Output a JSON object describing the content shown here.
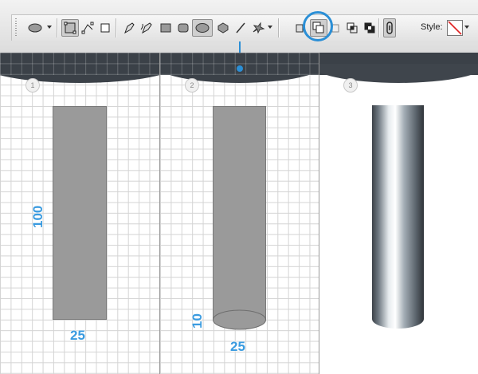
{
  "toolbar": {
    "style_label": "Style:",
    "tools": [
      {
        "name": "ellipse-preset-picker",
        "icon": "ellipse-icon"
      },
      {
        "name": "shape-layers-mode",
        "icon": "shape-layers-icon"
      },
      {
        "name": "paths-mode",
        "icon": "paths-icon"
      },
      {
        "name": "fill-pixels-mode",
        "icon": "fill-pixels-icon"
      },
      {
        "name": "pen-tool",
        "icon": "pen-icon"
      },
      {
        "name": "freeform-pen-tool",
        "icon": "freeform-pen-icon"
      },
      {
        "name": "rectangle-tool",
        "icon": "rectangle-icon"
      },
      {
        "name": "rounded-rectangle-tool",
        "icon": "rounded-rectangle-icon"
      },
      {
        "name": "ellipse-tool",
        "icon": "ellipse-icon"
      },
      {
        "name": "polygon-tool",
        "icon": "polygon-icon"
      },
      {
        "name": "line-tool",
        "icon": "line-icon"
      },
      {
        "name": "custom-shape-tool",
        "icon": "custom-shape-icon"
      },
      {
        "name": "create-new-shape-layer",
        "icon": "new-shape-layer-icon"
      },
      {
        "name": "add-to-shape-area",
        "icon": "add-shape-area-icon"
      },
      {
        "name": "subtract-from-shape-area",
        "icon": "subtract-shape-area-icon"
      },
      {
        "name": "intersect-shape-areas",
        "icon": "intersect-shape-icon"
      },
      {
        "name": "exclude-overlapping-areas",
        "icon": "exclude-shape-icon"
      },
      {
        "name": "link-style",
        "icon": "link-icon"
      },
      {
        "name": "style-swatch",
        "icon": "no-style-icon"
      }
    ],
    "accent_color": "#2b8fd6"
  },
  "steps": [
    {
      "number": "1",
      "dimensions": [
        "100",
        "25"
      ]
    },
    {
      "number": "2",
      "dimensions": [
        "10",
        "25"
      ]
    },
    {
      "number": "3",
      "dimensions": []
    }
  ],
  "colors": {
    "shape_gray": "#9a9a9a",
    "dome_dark": "#3b4148",
    "dimension_blue": "#3a9be0",
    "grid_line": "#d4d4d4"
  }
}
